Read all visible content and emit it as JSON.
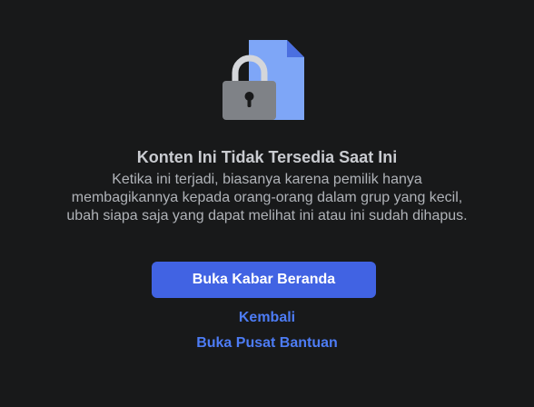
{
  "content_unavailable": {
    "illustration_icon": "locked-document-icon",
    "title": "Konten Ini Tidak Tersedia Saat Ini",
    "message": "Ketika ini terjadi, biasanya karena pemilik hanya membagikannya kepada orang-orang dalam grup yang kecil, ubah siapa saja yang dapat melihat ini atau ini sudah dihapus.",
    "primary_button_label": "Buka Kabar Beranda",
    "back_link_label": "Kembali",
    "help_link_label": "Buka Pusat Bantuan"
  },
  "colors": {
    "background": "#18191a",
    "title": "#c9cbd0",
    "message": "#b0b3b8",
    "primary_button": "#4163e3",
    "link": "#4d7cf5",
    "document": "#7ea6f7",
    "document_fold": "#4b6fe0",
    "lock_body": "#7f8287",
    "lock_shackle": "#d4d6da"
  }
}
